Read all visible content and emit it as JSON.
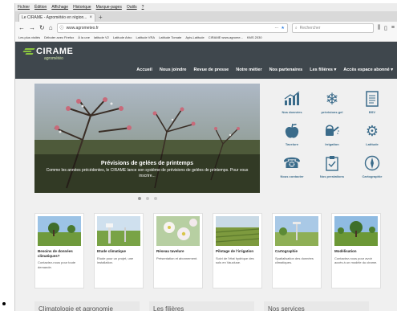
{
  "browser": {
    "menu": [
      "Fichier",
      "Édition",
      "Affichage",
      "Historique",
      "Marque-pages",
      "Outils",
      "?"
    ],
    "tab_title": "Le CIRAME - Agrométéo en région...",
    "tab_close": "×",
    "new_tab": "+",
    "url": "www.agrometeo.fr",
    "search_placeholder": "Rechercher",
    "bookmarks": [
      "Les plus visités",
      "Débuter avec Firefox",
      "À la une",
      "latitude V2",
      "Latitude Arbo",
      "Latitude VRA",
      "Latitude Tomate",
      "Apis-Latitude",
      "CIRAME www.agrome...",
      "KMS 2030"
    ]
  },
  "site": {
    "logo_name": "CIRAME",
    "logo_sub": "agrométéo",
    "nav": [
      "Accueil",
      "Nous joindre",
      "Revue de presse",
      "Notre métier",
      "Nos partenaires",
      "Les filières ▾",
      "Accès espace abonné ▾"
    ]
  },
  "slider": {
    "title": "Prévisions de gelées de printemps",
    "text": "Comme les années précédentes, le CIRAME lance son système de prévisions de gelées de printemps. Pour vous inscrire..."
  },
  "quick_links": [
    {
      "label": "Nos données",
      "icon": "chart-icon"
    },
    {
      "label": "prévisions gel",
      "icon": "snowflake-icon"
    },
    {
      "label": "BSV",
      "icon": "document-icon"
    },
    {
      "label": "Tavelure",
      "icon": "apple-icon"
    },
    {
      "label": "Irrigation",
      "icon": "watering-can-icon"
    },
    {
      "label": "Latitude",
      "icon": "gears-icon"
    },
    {
      "label": "Nous contacter",
      "icon": "phone-icon"
    },
    {
      "label": "Nos prestations",
      "icon": "clipboard-icon"
    },
    {
      "label": "Cartographie",
      "icon": "compass-icon"
    }
  ],
  "cards": [
    {
      "title": "Besoins de données climatiques?",
      "text": "Contactez-nous pour toute demande."
    },
    {
      "title": "Etude climatique",
      "text": "Etude pour un projet, une installation."
    },
    {
      "title": "Réseau tavelure",
      "text": "Présentation et abonnement."
    },
    {
      "title": "Pilotage de l'irrigation",
      "text": "Suivi de l'état hydrique des sols en Vaucluse."
    },
    {
      "title": "Cartographie",
      "text": "Spatialisation des données climatiques."
    },
    {
      "title": "Modélisation",
      "text": "Contactez-nous pour avoir accès à un modèle du cirame."
    }
  ],
  "bottom_sections": [
    "Climatologie et agronomie",
    "Les filières",
    "Nos services"
  ],
  "colors": {
    "header": "#3f474d",
    "accent": "#8ac43f",
    "link": "#3a6b8a"
  }
}
